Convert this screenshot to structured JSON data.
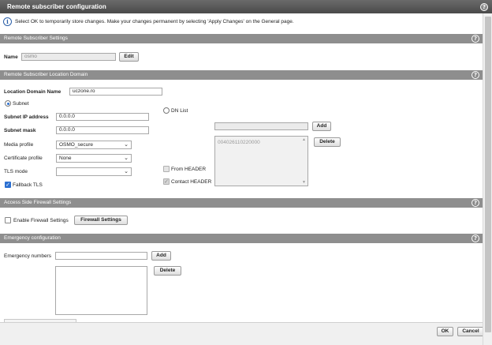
{
  "window": {
    "title": "Remote subscriber configuration"
  },
  "info": {
    "text": "Select OK to temporarily store changes. Make your changes permanent by selecting 'Apply Changes' on the General page."
  },
  "sections": {
    "remote_settings": "Remote Subscriber Settings",
    "location_domain": "Remote Subscriber Location Domain",
    "firewall": "Access Side Firewall Settings",
    "emergency": "Emergency configuration"
  },
  "name_row": {
    "label": "Name",
    "value": "osmo",
    "edit_label": "Edit"
  },
  "location": {
    "domain_label": "Location Domain Name",
    "domain_value": "uczone.ro",
    "subnet_label": "Subnet",
    "subnet_ip_label": "Subnet IP address",
    "subnet_ip_value": "0.0.0.0",
    "subnet_mask_label": "Subnet mask",
    "subnet_mask_value": "0.0.0.0",
    "media_profile_label": "Media profile",
    "media_profile_value": "OSMO_secure",
    "cert_profile_label": "Certificate profile",
    "cert_profile_value": "None",
    "tls_mode_label": "TLS mode",
    "tls_mode_value": "",
    "fallback_tls_label": "Fallback TLS",
    "dn_list_label": "DN List",
    "dn_add_label": "Add",
    "dn_delete_label": "Delete",
    "dn_items": [
      "004026110220000"
    ],
    "from_header_label": "From HEADER",
    "contact_header_label": "Contact HEADER"
  },
  "firewall": {
    "enable_label": "Enable Firewall Settings",
    "settings_button": "Firewall Settings"
  },
  "emergency": {
    "numbers_label": "Emergency numbers",
    "add_label": "Add",
    "delete_label": "Delete"
  },
  "footer": {
    "ok_label": "OK",
    "cancel_label": "Cancel"
  },
  "icons": {
    "help": "?",
    "info": "i",
    "check": "✓",
    "chevron": "⌄"
  }
}
